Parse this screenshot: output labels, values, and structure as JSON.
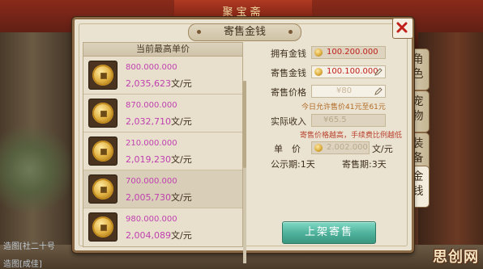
{
  "background": {
    "banner_text": "聚宝斋",
    "bottom_left_text": "造图[社二十号",
    "bottom_left_text2": "造图[成佳]"
  },
  "panel": {
    "title": "寄售金钱",
    "close_icon": "close-x-icon"
  },
  "side_tabs": [
    {
      "label": "角色",
      "active": false
    },
    {
      "label": "宠物",
      "active": false
    },
    {
      "label": "装备",
      "active": false
    },
    {
      "label": "金钱",
      "active": true
    }
  ],
  "list": {
    "header": "当前最高单价",
    "unit": "文/元",
    "rows": [
      {
        "amount": "800.000.000",
        "price": "2,035,623"
      },
      {
        "amount": "870.000.000",
        "price": "2,032,710"
      },
      {
        "amount": "210.000.000",
        "price": "2,019,230"
      },
      {
        "amount": "700.000.000",
        "price": "2,005,730"
      },
      {
        "amount": "980.000.000",
        "price": "2,004,089"
      }
    ]
  },
  "form": {
    "owned_label": "拥有金钱",
    "owned_value": "100.200.000",
    "sell_amount_label": "寄售金钱",
    "sell_amount_value": "100.100.000",
    "sell_price_label": "寄售价格",
    "sell_price_value": "¥80",
    "price_range_hint": "今日允许售价41元至61元",
    "income_label": "实际收入",
    "income_value": "¥65.5",
    "fee_hint": "寄售价格越高，手续费比例越低",
    "unit_price_label": "单　价",
    "unit_price_value": "2.002.000",
    "unit_price_unit": "文/元",
    "public_period_label": "公示期:1天",
    "sell_period_label": "寄售期:3天",
    "submit_label": "上架寄售"
  },
  "watermark": "思创网"
}
